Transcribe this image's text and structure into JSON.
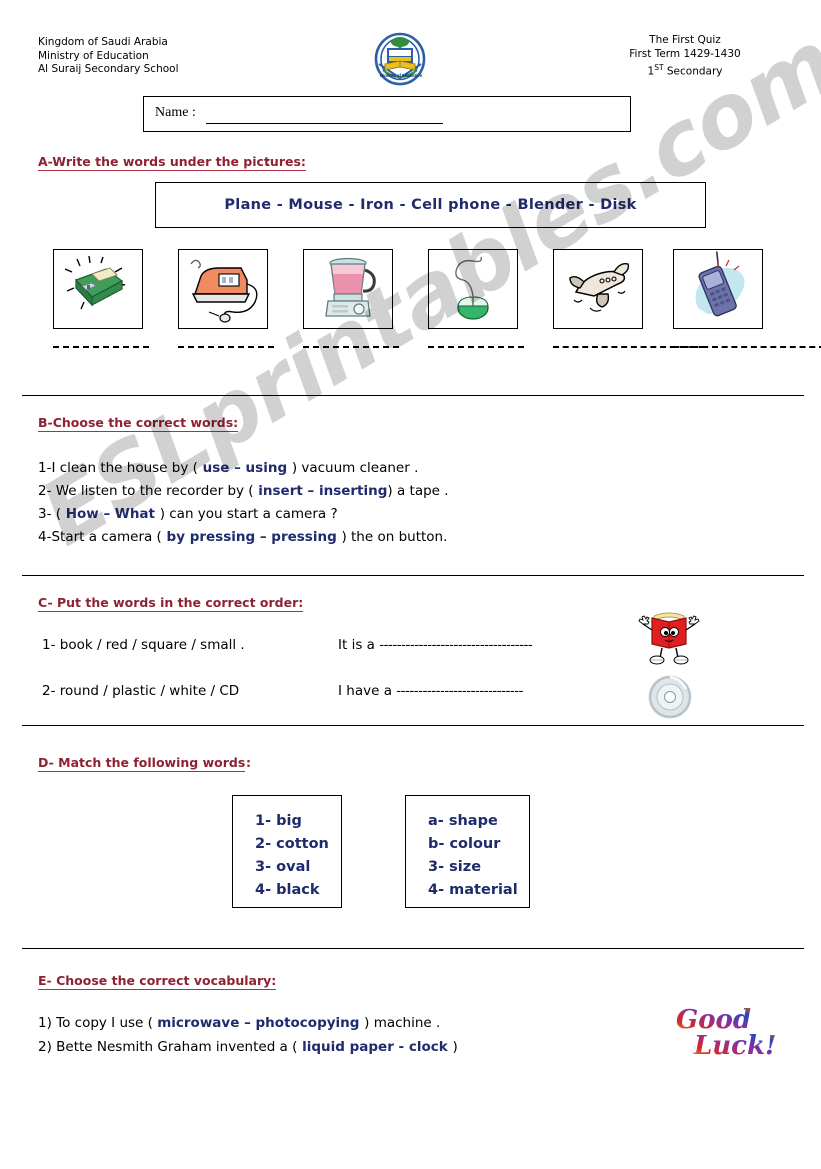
{
  "header": {
    "school_lines": [
      "Kingdom of Saudi Arabia",
      "Ministry of Education",
      "Al Suraij  Secondary School"
    ],
    "quiz_title": "The First  Quiz",
    "quiz_term": "First Term 1429-1430",
    "quiz_grade_number": "1",
    "quiz_grade_suffix": "ST",
    "quiz_grade_label": " Secondary",
    "logo_caption": "Ministry of Education"
  },
  "name_field": {
    "label": "Name :",
    "value": ""
  },
  "sections": {
    "a": {
      "heading": "A-Write the words under the pictures:",
      "heading_extra": ":",
      "word_bank": "Plane  -  Mouse -   Iron   - Cell phone - Blender   -  Disk",
      "pictures": [
        {
          "name": "disk",
          "answer": ""
        },
        {
          "name": "iron",
          "answer": ""
        },
        {
          "name": "blender",
          "answer": ""
        },
        {
          "name": "mouse",
          "answer": ""
        },
        {
          "name": "plane",
          "answer": ""
        },
        {
          "name": "cell-phone",
          "answer": ""
        }
      ]
    },
    "b": {
      "heading": "B-Choose the correct words:",
      "questions": [
        {
          "pre": "1-I clean the house by (",
          "choice": " use – using ",
          "post": ") vacuum cleaner ."
        },
        {
          "pre": "2- We  listen to the recorder by (",
          "choice": " insert – inserting",
          "post": ") a tape ."
        },
        {
          "pre": "3- (",
          "choice": " How – What ",
          "post": ") can you start a camera ?"
        },
        {
          "pre": "4-Start a camera  (",
          "choice": " by pressing – pressing ",
          "post": ") the on button."
        }
      ]
    },
    "c": {
      "heading": "C- Put the words in the correct order:",
      "rows": [
        {
          "prompt": "1- book / red / square / small .",
          "answer_lead": "It is a ",
          "answer_dashes": "-----------------------------------"
        },
        {
          "prompt": "2- round / plastic / white / CD",
          "answer_lead": "I have a ",
          "answer_dashes": "-----------------------------"
        }
      ]
    },
    "d": {
      "heading": "D- Match the  following words",
      "heading_extra": ":",
      "left_items": [
        "1- big",
        "2- cotton",
        "3- oval",
        "4- black"
      ],
      "right_items": [
        "a- shape",
        "b- colour",
        "3- size",
        "4- material"
      ]
    },
    "e": {
      "heading": "E- Choose the correct vocabulary:",
      "questions": [
        {
          "pre": "1) To copy I use ( ",
          "choice": " microwave  –  photocopying ",
          "post": ") machine ."
        },
        {
          "pre": "2) Bette Nesmith Graham  invented a (",
          "choice": " liquid paper  - clock ",
          "post": ")"
        }
      ]
    }
  },
  "footer": {
    "good_luck_line1": "Good",
    "good_luck_line2": "Luck!"
  },
  "watermark": {
    "text": "ESLprintables.com"
  },
  "colors": {
    "heading": "#8d2332",
    "choice": "#1f2b6c",
    "rule": "#000000"
  }
}
